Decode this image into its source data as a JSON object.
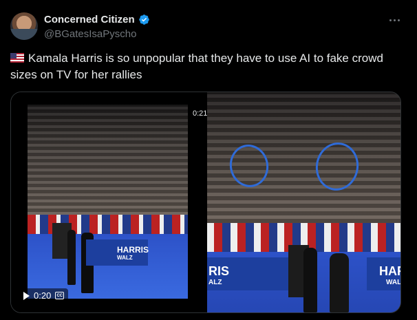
{
  "post": {
    "author": {
      "display_name": "Concerned Citizen",
      "handle": "@BGatesIsaPyscho",
      "verified": true
    },
    "text": "Kamala Harris is so unpopular that they have to use AI to fake crowd sizes on TV for her rallies",
    "flag_icon": "us-flag-icon"
  },
  "media": {
    "left_video": {
      "timestamp": "0:21",
      "elapsed": "0:20",
      "banner_title": "HARRIS",
      "banner_sub": "WALZ"
    },
    "right_image": {
      "banner_left_title": "RIS",
      "banner_left_sub": "ALZ",
      "banner_right_title": "HAR",
      "banner_right_sub": "WAL",
      "highlight_color": "#2f6bd8"
    }
  },
  "colors": {
    "background": "#000000",
    "primary_text": "#e7e9ea",
    "secondary_text": "#71767b",
    "verified": "#1d9bf0"
  }
}
